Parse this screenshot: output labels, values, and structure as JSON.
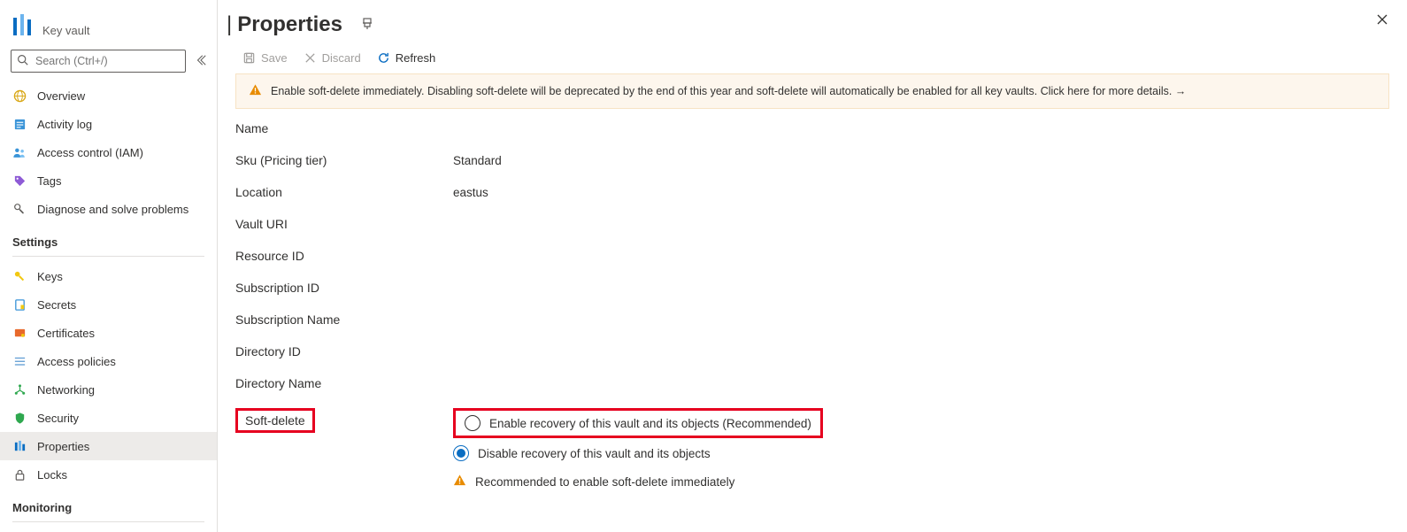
{
  "brand": {
    "label": "Key vault"
  },
  "search": {
    "placeholder": "Search (Ctrl+/)"
  },
  "nav": {
    "top": [
      {
        "label": "Overview"
      },
      {
        "label": "Activity log"
      },
      {
        "label": "Access control (IAM)"
      },
      {
        "label": "Tags"
      },
      {
        "label": "Diagnose and solve problems"
      }
    ],
    "sections": [
      {
        "title": "Settings",
        "items": [
          {
            "label": "Keys"
          },
          {
            "label": "Secrets"
          },
          {
            "label": "Certificates"
          },
          {
            "label": "Access policies"
          },
          {
            "label": "Networking"
          },
          {
            "label": "Security"
          },
          {
            "label": "Properties"
          },
          {
            "label": "Locks"
          }
        ]
      },
      {
        "title": "Monitoring",
        "items": []
      }
    ]
  },
  "page": {
    "title": "Properties"
  },
  "toolbar": {
    "save": "Save",
    "discard": "Discard",
    "refresh": "Refresh"
  },
  "banner": "Enable soft-delete immediately. Disabling soft-delete will be deprecated by the end of this year and soft-delete will automatically be enabled for all key vaults. Click here for more details. →",
  "props": {
    "name_label": "Name",
    "sku_label": "Sku (Pricing tier)",
    "sku_value": "Standard",
    "location_label": "Location",
    "location_value": "eastus",
    "vault_uri_label": "Vault URI",
    "resource_id_label": "Resource ID",
    "subscription_id_label": "Subscription ID",
    "subscription_name_label": "Subscription Name",
    "directory_id_label": "Directory ID",
    "directory_name_label": "Directory Name",
    "soft_delete_label": "Soft-delete",
    "soft_enable": "Enable recovery of this vault and its objects (Recommended)",
    "soft_disable": "Disable recovery of this vault and its objects",
    "soft_reco": "Recommended to enable soft-delete immediately"
  }
}
